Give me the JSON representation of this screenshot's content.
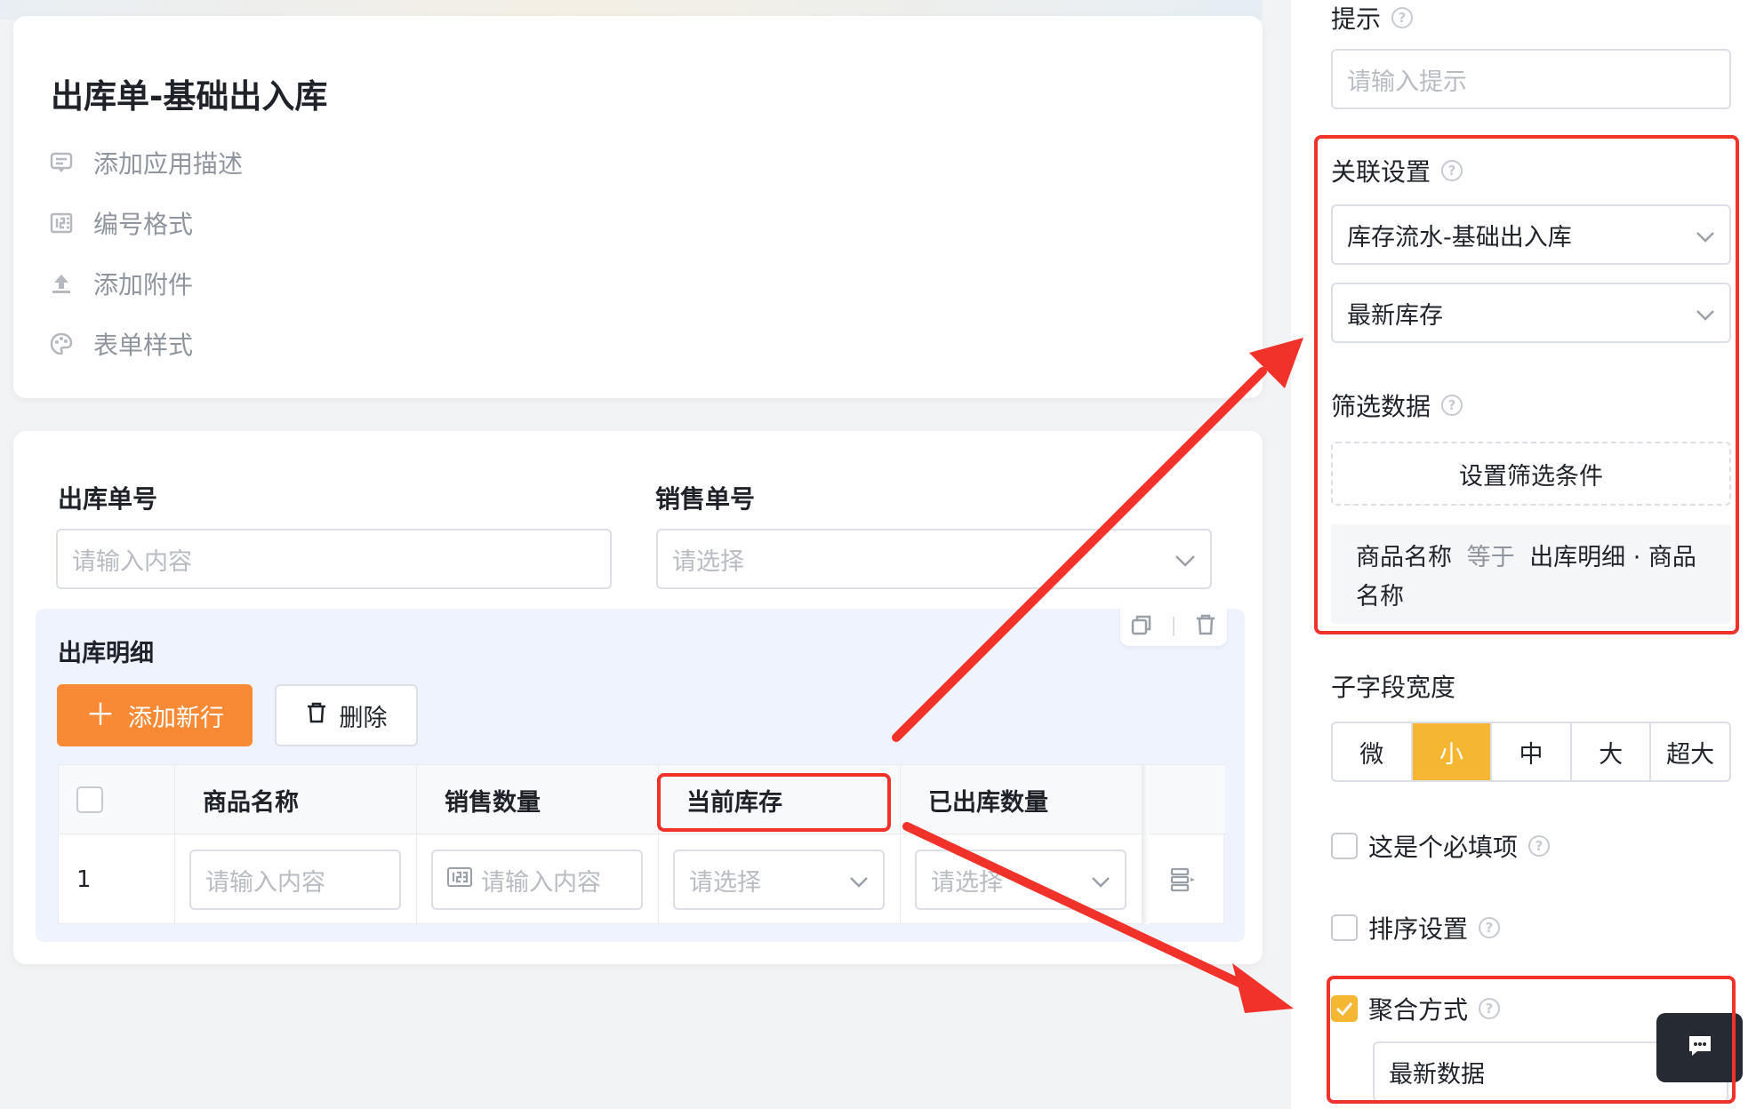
{
  "app": {
    "title": "出库单-基础出入库",
    "meta_items": [
      {
        "icon": "comment-icon",
        "label": "添加应用描述"
      },
      {
        "icon": "number-format-icon",
        "label": "编号格式"
      },
      {
        "icon": "upload-icon",
        "label": "添加附件"
      },
      {
        "icon": "palette-icon",
        "label": "表单样式"
      }
    ]
  },
  "form": {
    "fields": [
      {
        "label": "出库单号",
        "placeholder": "请输入内容"
      },
      {
        "label": "销售单号",
        "placeholder": "请选择"
      }
    ],
    "subform": {
      "title": "出库明细",
      "add_button": "添加新行",
      "delete_button": "删除",
      "columns": [
        "商品名称",
        "销售数量",
        "当前库存",
        "已出库数量"
      ],
      "row": {
        "index": "1",
        "cells": [
          "请输入内容",
          "请输入内容",
          "请选择",
          "请选择"
        ]
      }
    }
  },
  "panel": {
    "hint": {
      "label": "提示",
      "placeholder": "请输入提示"
    },
    "relation": {
      "label": "关联设置",
      "source": "库存流水-基础出入库",
      "field": "最新库存",
      "filter_label": "筛选数据",
      "filter_button": "设置筛选条件",
      "condition": {
        "field": "商品名称",
        "operator": "等于",
        "value": "出库明细 · 商品名称"
      }
    },
    "width": {
      "label": "子字段宽度",
      "options": [
        "微",
        "小",
        "中",
        "大",
        "超大"
      ],
      "selected": "小"
    },
    "required": {
      "label": "这是个必填项",
      "checked": false
    },
    "sort": {
      "label": "排序设置",
      "checked": false
    },
    "aggregate": {
      "label": "聚合方式",
      "checked": true,
      "value": "最新数据"
    }
  },
  "colors": {
    "accent": "#f5b731",
    "orange": "#f98a35",
    "annotation": "#f0322b"
  }
}
